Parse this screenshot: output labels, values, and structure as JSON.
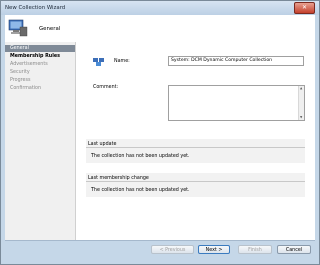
{
  "window": {
    "title": "New Collection Wizard"
  },
  "header": {
    "label": "General"
  },
  "nav": {
    "items": [
      {
        "label": "General"
      },
      {
        "label": "Membership Rules"
      },
      {
        "label": "Advertisements"
      },
      {
        "label": "Security"
      },
      {
        "label": "Progress"
      },
      {
        "label": "Confirmation"
      }
    ]
  },
  "form": {
    "name_label": "Name:",
    "name_value": "System: DCM Dynamic Computer Collection",
    "comment_label": "Comment:"
  },
  "last_update": {
    "heading": "Last update",
    "text": "The collection has not been updated yet."
  },
  "last_membership_change": {
    "heading": "Last membership change",
    "text": "The collection has not been updated yet."
  },
  "buttons": {
    "previous": "< Previous",
    "next": "Next >",
    "finish": "Finish",
    "cancel": "Cancel"
  },
  "colors": {
    "selected_nav": "#7f8a97",
    "frame": "#c5d7e8"
  }
}
